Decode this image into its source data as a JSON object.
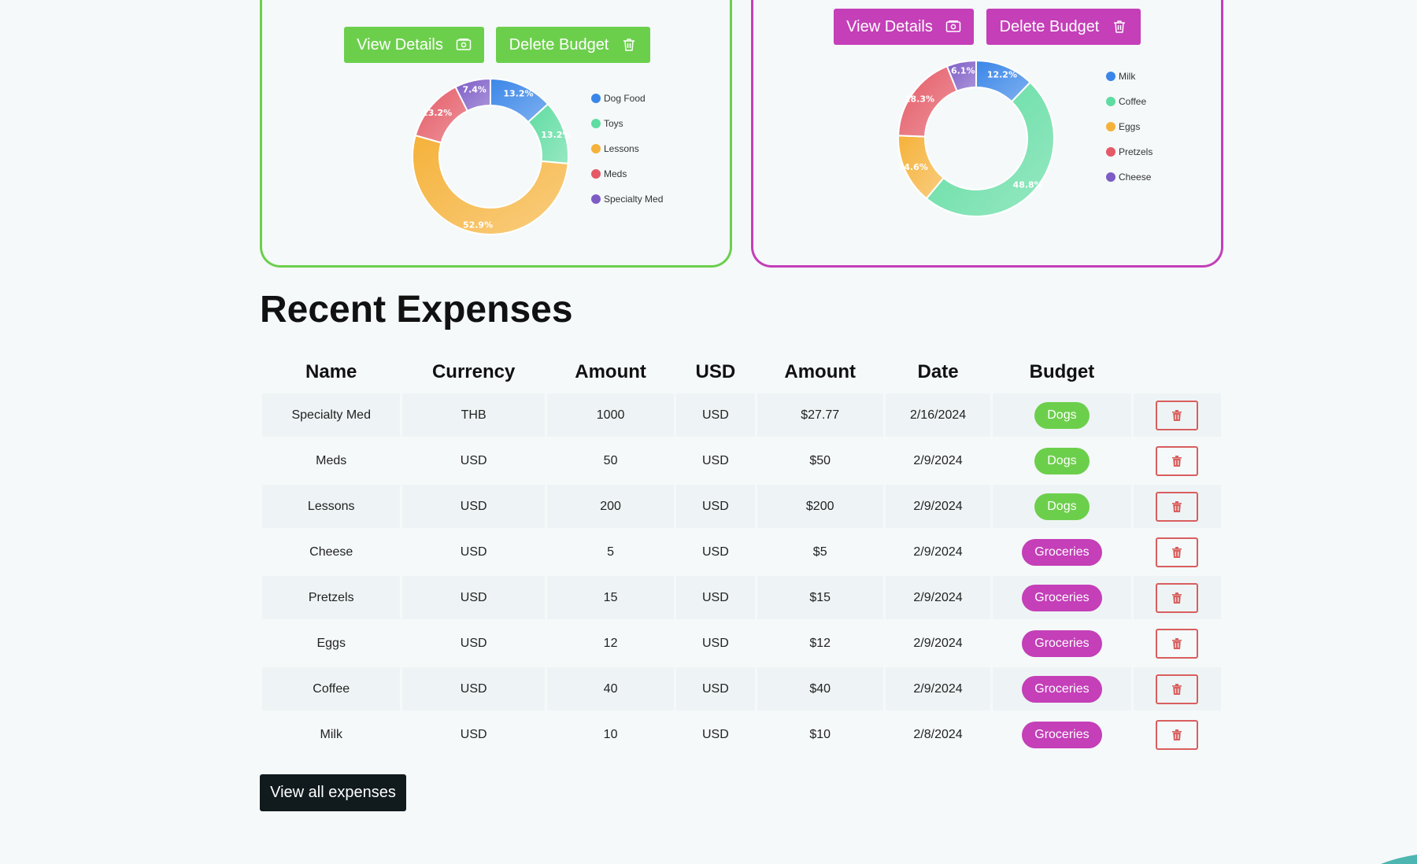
{
  "budgets": [
    {
      "color": "#6ccf4c",
      "buttons": {
        "view_details": "View Details",
        "delete_budget": "Delete Budget"
      },
      "chart_data": {
        "type": "pie",
        "donut": true,
        "categories": [
          "Dog Food",
          "Toys",
          "Lessons",
          "Meds",
          "Specialty Med"
        ],
        "values": [
          13.2,
          13.2,
          52.9,
          13.2,
          7.4
        ],
        "labels": [
          "13.2%",
          "13.2%",
          "52.9%",
          "13.2%",
          "7.4%"
        ],
        "colors": [
          "#3a86e8",
          "#5fdca1",
          "#f5b23a",
          "#e45a66",
          "#7d5cc6"
        ],
        "legend": "right"
      }
    },
    {
      "color": "#c43fb8",
      "buttons": {
        "view_details": "View Details",
        "delete_budget": "Delete Budget"
      },
      "chart_data": {
        "type": "pie",
        "donut": true,
        "categories": [
          "Milk",
          "Coffee",
          "Eggs",
          "Pretzels",
          "Cheese"
        ],
        "values": [
          12.2,
          48.8,
          14.6,
          18.3,
          6.1
        ],
        "labels": [
          "12.2%",
          "48.8%",
          "14.6%",
          "18.3%",
          "6.1%"
        ],
        "colors": [
          "#3a86e8",
          "#5fdca1",
          "#f5b23a",
          "#e45a66",
          "#7d5cc6"
        ],
        "legend": "right"
      }
    }
  ],
  "recent_expenses": {
    "title": "Recent Expenses",
    "headers": [
      "Name",
      "Currency",
      "Amount",
      "USD",
      "Amount",
      "Date",
      "Budget"
    ],
    "rows": [
      {
        "name": "Specialty Med",
        "currency": "THB",
        "amount": "1000",
        "usd": "USD",
        "usd_amount": "$27.77",
        "date": "2/16/2024",
        "budget": "Dogs",
        "budget_color": "#6ccf4c"
      },
      {
        "name": "Meds",
        "currency": "USD",
        "amount": "50",
        "usd": "USD",
        "usd_amount": "$50",
        "date": "2/9/2024",
        "budget": "Dogs",
        "budget_color": "#6ccf4c"
      },
      {
        "name": "Lessons",
        "currency": "USD",
        "amount": "200",
        "usd": "USD",
        "usd_amount": "$200",
        "date": "2/9/2024",
        "budget": "Dogs",
        "budget_color": "#6ccf4c"
      },
      {
        "name": "Cheese",
        "currency": "USD",
        "amount": "5",
        "usd": "USD",
        "usd_amount": "$5",
        "date": "2/9/2024",
        "budget": "Groceries",
        "budget_color": "#c43fb8"
      },
      {
        "name": "Pretzels",
        "currency": "USD",
        "amount": "15",
        "usd": "USD",
        "usd_amount": "$15",
        "date": "2/9/2024",
        "budget": "Groceries",
        "budget_color": "#c43fb8"
      },
      {
        "name": "Eggs",
        "currency": "USD",
        "amount": "12",
        "usd": "USD",
        "usd_amount": "$12",
        "date": "2/9/2024",
        "budget": "Groceries",
        "budget_color": "#c43fb8"
      },
      {
        "name": "Coffee",
        "currency": "USD",
        "amount": "40",
        "usd": "USD",
        "usd_amount": "$40",
        "date": "2/9/2024",
        "budget": "Groceries",
        "budget_color": "#c43fb8"
      },
      {
        "name": "Milk",
        "currency": "USD",
        "amount": "10",
        "usd": "USD",
        "usd_amount": "$10",
        "date": "2/8/2024",
        "budget": "Groceries",
        "budget_color": "#c43fb8"
      }
    ],
    "delete_icon": "trash-icon",
    "view_all_label": "View all expenses"
  },
  "icons": {
    "view_details": "money-icon",
    "delete_budget": "trash-icon"
  }
}
